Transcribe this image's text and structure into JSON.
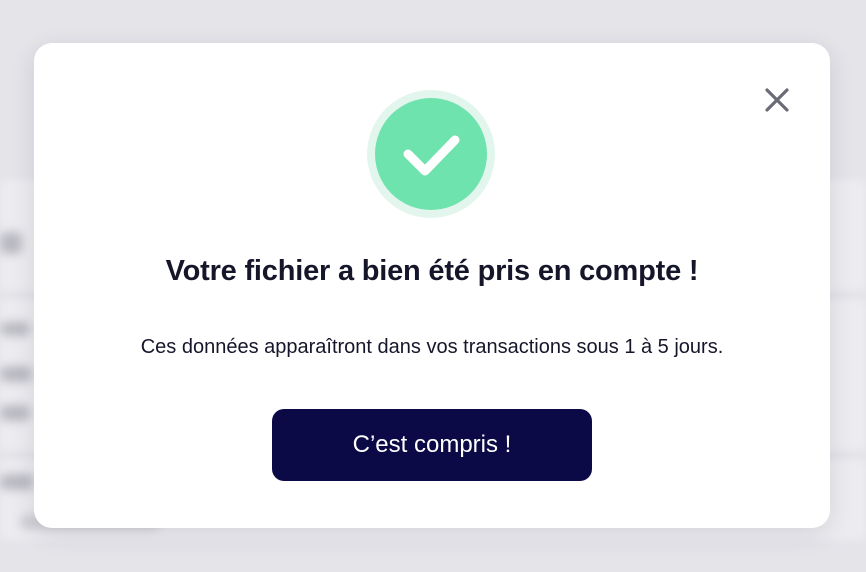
{
  "modal": {
    "title": "Votre fichier a bien été pris en compte !",
    "message": "Ces données apparaîtront dans vos transactions sous 1 à 5 jours.",
    "confirm_label": "C’est compris !",
    "close_icon": "close-icon",
    "status_icon": "check-icon"
  },
  "colors": {
    "success": "#6fe3ad",
    "success_halo": "#e3f6ed",
    "primary_button": "#0c0a46",
    "text": "#16162b",
    "close_icon": "#6b6b78"
  }
}
